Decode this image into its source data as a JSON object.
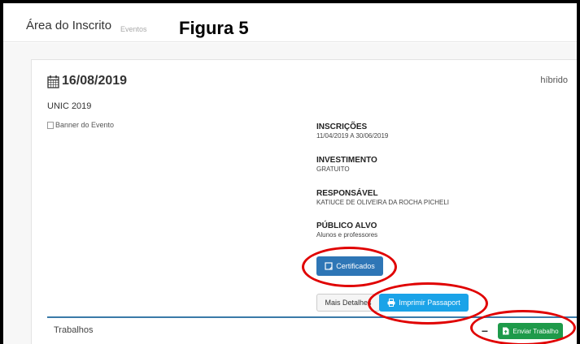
{
  "header": {
    "title": "Área do Inscrito",
    "crumb": "Eventos",
    "figure_label": "Figura 5"
  },
  "event": {
    "date": "16/08/2019",
    "modality": "híbrido",
    "name": "UNIC 2019",
    "banner_alt": "Banner do Evento"
  },
  "details": {
    "inscricoes_label": "INSCRIÇÕES",
    "inscricoes_value": "11/04/2019 A 30/06/2019",
    "investimento_label": "INVESTIMENTO",
    "investimento_value": "GRATUITO",
    "responsavel_label": "RESPONSÁVEL",
    "responsavel_value": "KATIUCE DE OLIVEIRA DA ROCHA PICHELI",
    "publico_label": "PÚBLICO ALVO",
    "publico_value": "Alunos e professores"
  },
  "actions": {
    "certificados": "Certificados",
    "mais_detalhes": "Mais Detalhes",
    "imprimir": "Imprimir Passaport",
    "enviar_trabalho": "Enviar Trabalho",
    "minus": "−"
  },
  "section": {
    "trabalhos": "Trabalhos"
  },
  "colors": {
    "primary": "#2e76b6",
    "info": "#1aa3e8",
    "success": "#1e9a4a",
    "highlight": "#e00000"
  },
  "icons": {
    "date": "calendar-icon",
    "certificados": "certificate-icon",
    "imprimir": "print-icon",
    "enviar": "file-upload-icon"
  }
}
